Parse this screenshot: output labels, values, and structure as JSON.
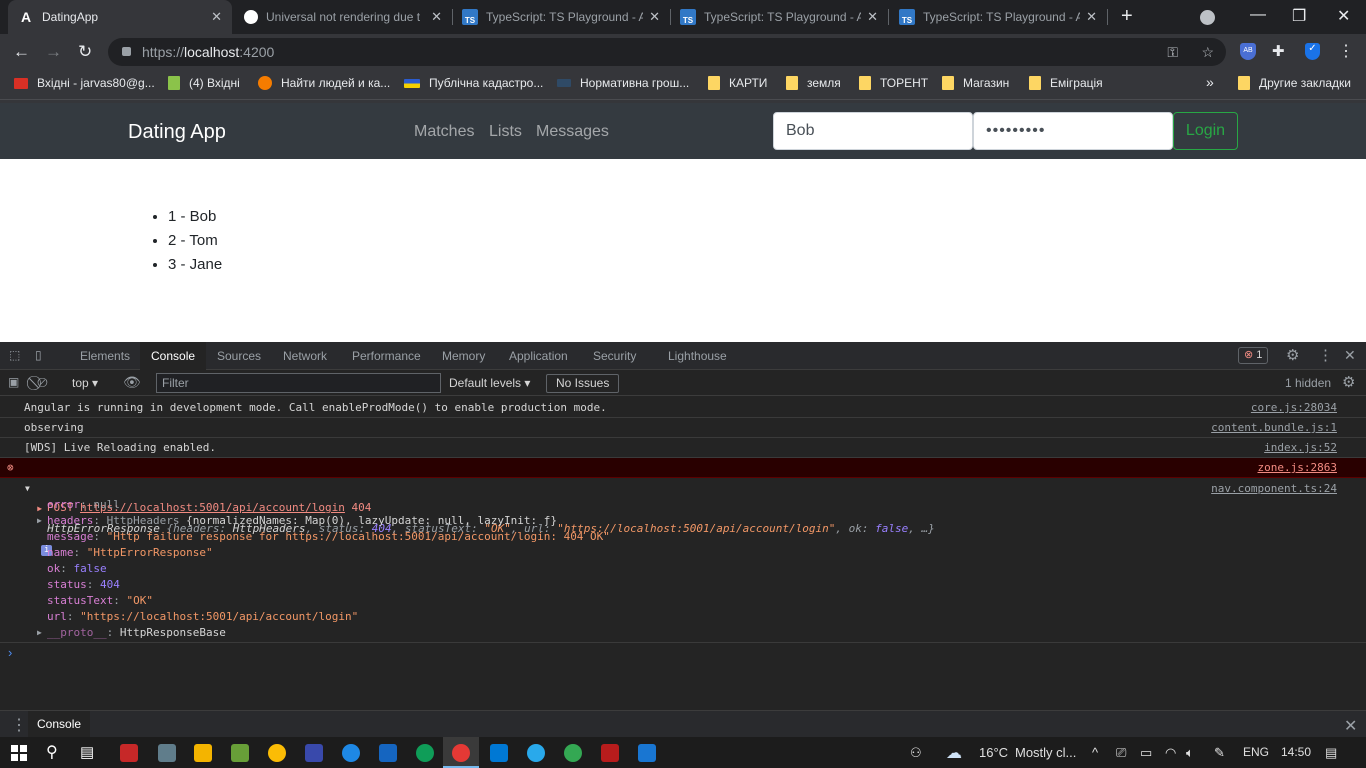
{
  "browser": {
    "tabs": [
      {
        "title": "DatingApp",
        "active": true
      },
      {
        "title": "Universal not rendering due t"
      },
      {
        "title": "TypeScript: TS Playground - A"
      },
      {
        "title": "TypeScript: TS Playground - A"
      },
      {
        "title": "TypeScript: TS Playground - A"
      }
    ],
    "ts_badge": "TS",
    "url_scheme": "https://",
    "url_host": "localhost",
    "url_port": ":4200",
    "ext_ab": "AB",
    "bookmarks": [
      "Вхідні - jarvas80@g...",
      "(4) Вхідні",
      "Найти людей и ка...",
      "Публічна кадастро...",
      "Нормативна грош...",
      "КАРТИ",
      "земля",
      "ТОРЕНТ",
      "Магазин",
      "Еміграція"
    ],
    "other_bookmarks": "Другие закладки"
  },
  "app": {
    "brand": "Dating App",
    "nav": [
      "Matches",
      "Lists",
      "Messages"
    ],
    "username": "Bob",
    "password": "•••••••••",
    "login": "Login",
    "values": [
      "1 - Bob",
      "2 - Tom",
      "3 - Jane"
    ]
  },
  "devtools": {
    "tabs": [
      "Elements",
      "Console",
      "Sources",
      "Network",
      "Performance",
      "Memory",
      "Application",
      "Security",
      "Lighthouse"
    ],
    "error_count": "1",
    "context": "top",
    "filter_placeholder": "Filter",
    "levels": "Default levels",
    "issues": "No Issues",
    "hidden": "1 hidden",
    "logs": [
      {
        "text": "Angular is running in development mode. Call enableProdMode() to enable production mode.",
        "source": "core.js:28034"
      },
      {
        "text": "observing",
        "source": "content.bundle.js:1"
      },
      {
        "text": "[WDS] Live Reloading enabled.",
        "source": "index.js:52"
      },
      {
        "method": "POST",
        "url": "https://localhost:5001/api/account/login",
        "status": "404",
        "source": "zone.js:2863"
      }
    ],
    "obj": {
      "source": "nav.component.ts:24",
      "summary": {
        "a": "HttpErrorResponse ",
        "b": "{headers: ",
        "c": "HttpHeaders",
        "d": ", status: ",
        "e": "404",
        "f": ", statusText: ",
        "g": "\"OK\"",
        "h": ", url: ",
        "i": "\"https://localhost:5001/api/account/login\"",
        "j": ", ok: ",
        "k": "false",
        "l": ", …}",
        "info": "i"
      },
      "props": [
        {
          "k": "error",
          "v": "null"
        },
        {
          "k": "headers",
          "v": "HttpHeaders",
          "rest": " {normalizedNames: Map(0), lazyUpdate: null, lazyInit: ƒ}"
        },
        {
          "k": "message",
          "v": "\"Http failure response for https://localhost:5001/api/account/login: 404 OK\""
        },
        {
          "k": "name",
          "v": "\"HttpErrorResponse\""
        },
        {
          "k": "ok",
          "v": "false"
        },
        {
          "k": "status",
          "v": "404"
        },
        {
          "k": "statusText",
          "v": "\"OK\""
        },
        {
          "k": "url",
          "v": "\"https://localhost:5001/api/account/login\""
        },
        {
          "k": "__proto__",
          "v": "HttpResponseBase"
        }
      ]
    },
    "prompt": "›",
    "drawer_tab": "Console"
  },
  "taskbar": {
    "temp": "16°C",
    "weather": "Mostly cl...",
    "lang": "ENG",
    "time": "14:50"
  }
}
